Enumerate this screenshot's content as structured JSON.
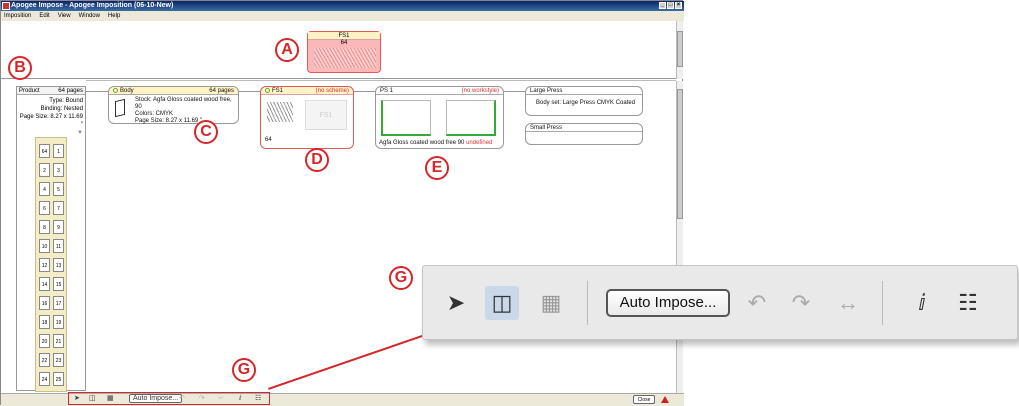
{
  "window": {
    "title": "Apogee Impose - Apogee Imposition (06-10-New)",
    "menu": [
      "Imposition",
      "Edit",
      "View",
      "Window",
      "Help"
    ]
  },
  "top": {
    "fs1_label": "FS1",
    "fs1_count": "64"
  },
  "product": {
    "label": "Product",
    "pages": "64 pages",
    "type": "Type: Bound",
    "binding": "Binding: Nested",
    "page_size": "Page Size: 8.27 x 11.69 \"",
    "page_pairs": [
      [
        "64",
        "1"
      ],
      [
        "2",
        "3"
      ],
      [
        "4",
        "5"
      ],
      [
        "6",
        "7"
      ],
      [
        "8",
        "9"
      ],
      [
        "10",
        "11"
      ],
      [
        "12",
        "13"
      ],
      [
        "14",
        "15"
      ],
      [
        "16",
        "17"
      ],
      [
        "18",
        "19"
      ],
      [
        "20",
        "21"
      ],
      [
        "22",
        "23"
      ],
      [
        "24",
        "25"
      ]
    ]
  },
  "body_card": {
    "label": "Body",
    "pages": "64 pages",
    "stock": "Stock: Agfa Gloss coated wood free, 90",
    "colors": "Colors: CMYK",
    "page_size": "Page Size: 8.27 x 11.69 \""
  },
  "fs1_card": {
    "label": "FS1",
    "status": "(no scheme)",
    "ghost": "FS1",
    "count": "64"
  },
  "ps1_card": {
    "label": "PS 1",
    "status": "(no workstyle)",
    "stock": "Agfa Gloss coated wood free",
    "weight": "90",
    "undefined": "undefined"
  },
  "large_press": {
    "label": "Large Press",
    "body": "Body set:",
    "value": "Large Press CMYK Coated"
  },
  "small_press": {
    "label": "Small Press"
  },
  "callouts": {
    "a": "A",
    "b": "B",
    "c": "C",
    "d": "D",
    "e": "E",
    "g": "G"
  },
  "toolbar": {
    "auto_impose": "Auto Impose...",
    "close": "Close"
  },
  "colors": {
    "accent": "#d6262a",
    "pink": "#fbb8b8",
    "header": "#fff3c6"
  }
}
